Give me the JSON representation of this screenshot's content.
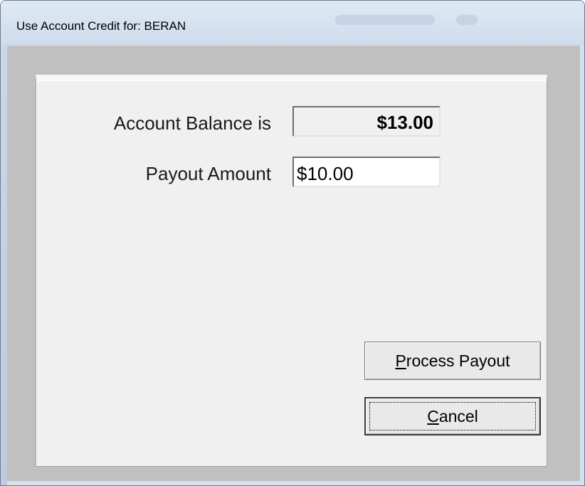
{
  "window": {
    "title": "Use Account Credit for: BERAN"
  },
  "form": {
    "balance_label": "Account Balance is",
    "balance_value": "$13.00",
    "payout_label": "Payout Amount",
    "payout_value": "$10.00"
  },
  "buttons": {
    "process": {
      "mnemonic": "P",
      "rest": "rocess Payout"
    },
    "cancel": {
      "mnemonic": "C",
      "rest": "ancel"
    }
  }
}
